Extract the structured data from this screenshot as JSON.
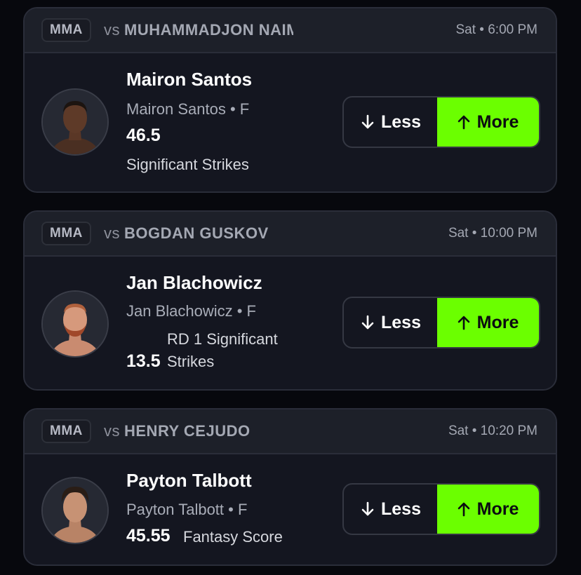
{
  "cards": [
    {
      "sport": "MMA",
      "vs_prefix": "vs",
      "opponent": "MUHAMMADJON NAIMOV",
      "time": "Sat • 6:00 PM",
      "player_name": "Mairon Santos",
      "player_sub": "Mairon Santos • F",
      "line": "46.5",
      "stat": "Significant Strikes",
      "less_label": "Less",
      "more_label": "More"
    },
    {
      "sport": "MMA",
      "vs_prefix": "vs",
      "opponent": "BOGDAN GUSKOV",
      "time": "Sat • 10:00 PM",
      "player_name": "Jan Blachowicz",
      "player_sub": "Jan Blachowicz • F",
      "line": "13.5",
      "stat_line1": "RD 1 Significant",
      "stat_line2": "Strikes",
      "less_label": "Less",
      "more_label": "More"
    },
    {
      "sport": "MMA",
      "vs_prefix": "vs",
      "opponent": "HENRY CEJUDO",
      "time": "Sat • 10:20 PM",
      "player_name": "Payton Talbott",
      "player_sub": "Payton Talbott • F",
      "line": "45.55",
      "stat": "Fantasy Score",
      "less_label": "Less",
      "more_label": "More"
    }
  ],
  "colors": {
    "more_accent": "#6bff00",
    "card_bg": "#141620",
    "header_bg": "#1d2029",
    "page_bg": "#07080d"
  },
  "icons": {
    "less": "arrow-down-icon",
    "more": "arrow-up-icon"
  }
}
